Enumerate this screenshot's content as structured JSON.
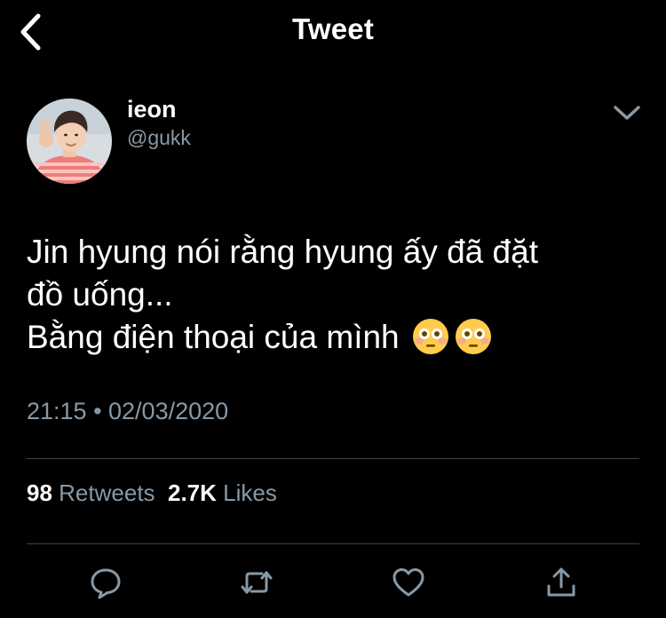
{
  "header": {
    "title": "Tweet"
  },
  "author": {
    "name": "ieon",
    "handle": "@gukk"
  },
  "tweet": {
    "lines": [
      "Jin hyung nói rằng hyung ấy đã đặt",
      "đồ uống...",
      "Bằng điện thoại của mình"
    ],
    "emojis": [
      "flushed-face",
      "flushed-face"
    ],
    "timestamp": "21:15 • 02/03/2020"
  },
  "stats": {
    "retweets_count": "98",
    "retweets_label": "Retweets",
    "likes_count": "2.7K",
    "likes_label": "Likes"
  },
  "actions": [
    "reply",
    "retweet",
    "like",
    "share"
  ],
  "colors": {
    "background": "#000000",
    "text": "#ffffff",
    "secondary_text": "#8899a6",
    "divider": "#38444d"
  }
}
